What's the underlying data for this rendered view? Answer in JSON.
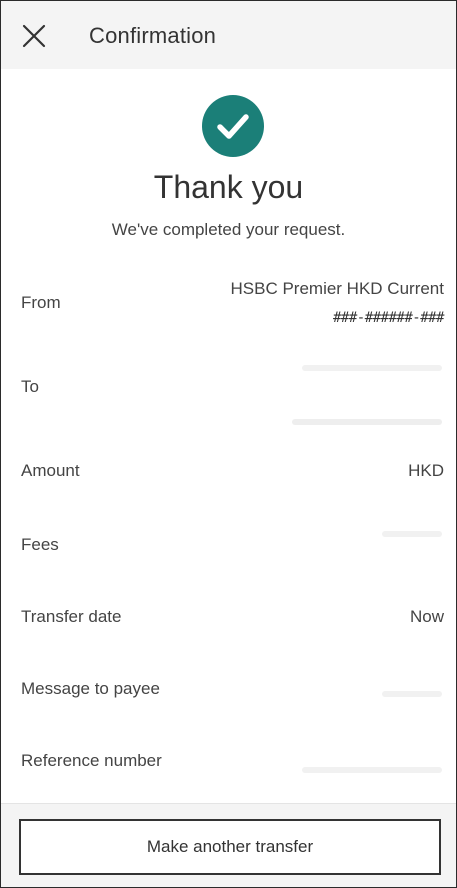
{
  "header": {
    "close_icon": "close-icon",
    "title": "Confirmation"
  },
  "status": {
    "icon": "check-circle-icon",
    "icon_color": "#1b7f78",
    "heading": "Thank you",
    "message": "We've completed your request."
  },
  "details": {
    "from": {
      "label": "From",
      "account_name": "HSBC Premier HKD Current",
      "account_number": "###-######-###"
    },
    "to": {
      "label": "To"
    },
    "amount": {
      "label": "Amount",
      "value": "HKD"
    },
    "fees": {
      "label": "Fees"
    },
    "transfer_date": {
      "label": "Transfer date",
      "value": "Now"
    },
    "message_to_payee": {
      "label": "Message to payee"
    },
    "reference_number": {
      "label": "Reference number"
    }
  },
  "footer": {
    "button_label": "Make another transfer"
  }
}
